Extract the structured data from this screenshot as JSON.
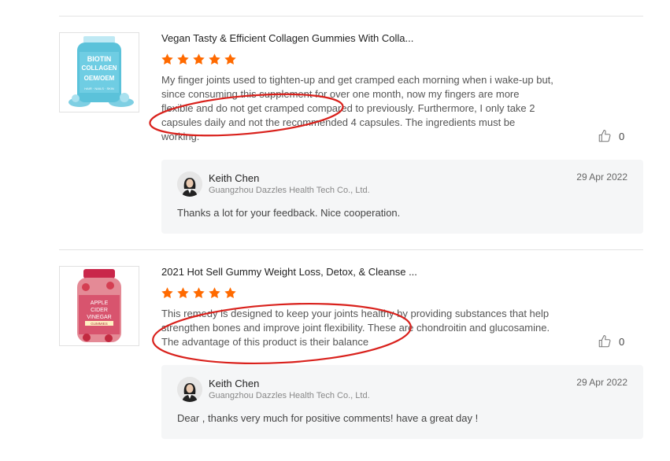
{
  "reviews": [
    {
      "product_title": "Vegan Tasty & Efficient Collagen Gummies With Colla...",
      "rating": 5,
      "image_text": [
        "BIOTIN",
        "COLLAGEN",
        "OEM/OEM",
        "HAIR · NAILS · SKIN"
      ],
      "comment": "My finger joints used to tighten-up and get cramped each morning when i wake-up but, since consuming this supplement for over one month, now my fingers are more flexible and do not get cramped compared to previously. Furthermore, I only take 2 capsules daily and not the recommended 4 capsules. The ingredients must be working.",
      "likes": "0",
      "reply": {
        "name": "Keith Chen",
        "company": "Guangzhou Dazzles Health Tech Co., Ltd.",
        "date": "29 Apr 2022",
        "text": "Thanks a lot for your feedback. Nice cooperation."
      }
    },
    {
      "product_title": "2021 Hot Sell Gummy Weight Loss, Detox, & Cleanse ...",
      "rating": 5,
      "image_text": [
        "APPLE",
        "CIDER",
        "VINEGAR",
        "GUMMIES"
      ],
      "comment": "This remedy is designed to keep your joints healthy by providing substances that help strengthen bones and improve joint flexibility. These are chondroitin and glucosamine. The advantage of this product is their balance",
      "likes": "0",
      "reply": {
        "name": "Keith Chen",
        "company": "Guangzhou Dazzles Health Tech Co., Ltd.",
        "date": "29 Apr 2022",
        "text": "Dear , thanks very much for positive comments! have a great day !"
      }
    }
  ],
  "colors": {
    "star": "#ff6a00",
    "annotation": "#d9211c",
    "divider": "#e3e3e3",
    "reply_bg": "#f5f6f7"
  },
  "icons": {
    "rating": "star-icon",
    "like": "thumbs-up-icon"
  }
}
